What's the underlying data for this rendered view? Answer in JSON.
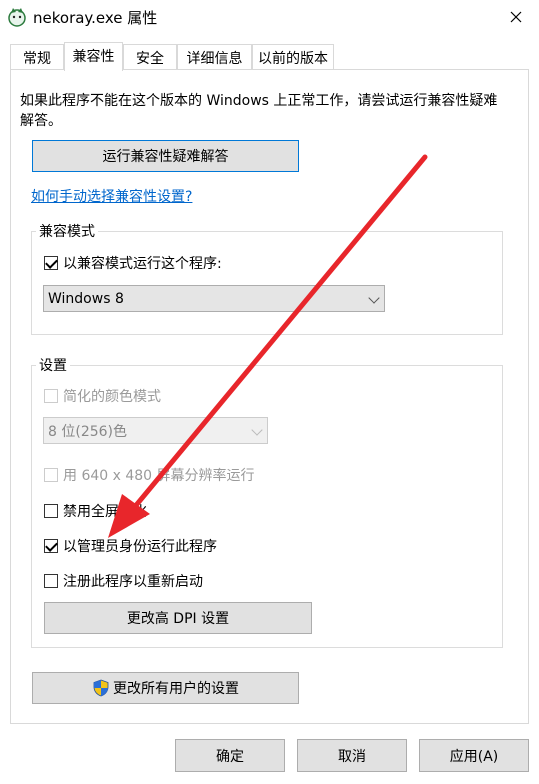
{
  "window": {
    "title": "nekoray.exe 属性"
  },
  "tabs": [
    {
      "label": "常规"
    },
    {
      "label": "兼容性"
    },
    {
      "label": "安全"
    },
    {
      "label": "详细信息"
    },
    {
      "label": "以前的版本"
    }
  ],
  "compat": {
    "description": "如果此程序不能在这个版本的 Windows 上正常工作，请尝试运行兼容性疑难解答。",
    "troubleshooter_button": "运行兼容性疑难解答",
    "manual_link": "如何手动选择兼容性设置?"
  },
  "compat_mode": {
    "group_label": "兼容模式",
    "run_in_compat_label": "以兼容模式运行这个程序:",
    "selected_os": "Windows 8"
  },
  "settings": {
    "group_label": "设置",
    "reduced_color_label": "简化的颜色模式",
    "color_select": "8 位(256)色",
    "res640_label": "用 640 x 480 屏幕分辨率运行",
    "disable_fullscreen_label": "禁用全屏优化",
    "run_as_admin_label": "以管理员身份运行此程序",
    "register_restart_label": "注册此程序以重新启动",
    "dpi_button": "更改高 DPI 设置"
  },
  "all_users_button": "更改所有用户的设置",
  "footer": {
    "ok": "确定",
    "cancel": "取消",
    "apply": "应用(A)"
  },
  "colors": {
    "accent": "#0078d7",
    "link": "#0066cc",
    "arrow": "#e8262b"
  }
}
